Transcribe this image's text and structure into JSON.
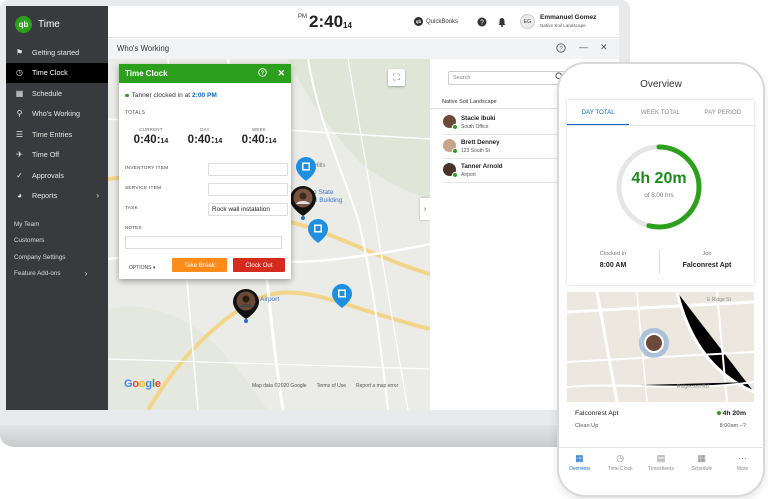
{
  "app": {
    "name": "Time",
    "logo": "qb"
  },
  "sidebar": {
    "items": [
      {
        "label": "Getting started",
        "icon": "flag-icon"
      },
      {
        "label": "Time Clock",
        "icon": "clock-icon",
        "active": true
      },
      {
        "label": "Schedule",
        "icon": "calendar-icon"
      },
      {
        "label": "Who's Working",
        "icon": "map-pin-icon"
      },
      {
        "label": "Time Entries",
        "icon": "list-icon"
      },
      {
        "label": "Time Off",
        "icon": "plane-icon"
      },
      {
        "label": "Approvals",
        "icon": "check-icon"
      },
      {
        "label": "Reports",
        "icon": "pie-chart-icon"
      }
    ],
    "links": [
      "My Team",
      "Customers",
      "Company Settings",
      "Feature Add-ons"
    ]
  },
  "header": {
    "ampm": "PM",
    "time": "2:40",
    "seconds": "14",
    "quickbooks_label": "QuickBooks",
    "qb_badge": "qb",
    "user_initials": "EG",
    "user_name": "Emmanuel Gomez",
    "company": "Native Soil Landscape"
  },
  "subheader": {
    "title": "Who's Working"
  },
  "time_clock": {
    "title": "Time Clock",
    "status_prefix": "Tanner clocked in at",
    "clock_in_time": "2:00 PM",
    "totals_label": "TOTALS",
    "totals": [
      {
        "label": "CURRENT",
        "value": "0:40:",
        "sec": "14"
      },
      {
        "label": "DAY",
        "value": "0:40:",
        "sec": "14"
      },
      {
        "label": "WEEK",
        "value": "0:40:",
        "sec": "14"
      }
    ],
    "fields": [
      {
        "label": "INVENTORY ITEM",
        "value": ""
      },
      {
        "label": "SERVICE ITEM",
        "value": ""
      },
      {
        "label": "TASK",
        "value": "Rock wall instalation"
      }
    ],
    "notes_label": "NOTES",
    "options_label": "OPTIONS ▾",
    "take_break_label": "Take Break",
    "clock_out_label": "Clock Out"
  },
  "map": {
    "labels": {
      "hills": "Hills",
      "state": "o State",
      "capitol": "l Building",
      "airport": "Airport",
      "google": "Google"
    },
    "footer": [
      "Map data ©2020 Google",
      "Terms of Use",
      "Report a map error"
    ]
  },
  "who_working": {
    "search_placeholder": "Search",
    "group": "Native Soil Landscape",
    "employees": [
      {
        "name": "Stacie Ibuki",
        "location": "South Office"
      },
      {
        "name": "Brett Denney",
        "location": "123 South St"
      },
      {
        "name": "Tanner Arnold",
        "location": "Airport"
      }
    ]
  },
  "phone": {
    "title": "Overview",
    "tabs": [
      "DAY TOTAL",
      "WEEK TOTAL",
      "PAY PERIOD"
    ],
    "ring_value": "4h 20m",
    "ring_sub": "of 8.00 hrs",
    "ring_progress": 0.54,
    "clocked_in_label": "Clocked In",
    "clocked_in_value": "8:00 AM",
    "job_label": "Job",
    "job_value": "Falconrest Apt",
    "map_street_1": "E Ridge St",
    "map_street_2": "Ridgecrest Rd",
    "loc_name": "Falconrest Apt",
    "loc_duration": "4h 20m",
    "loc_task": "Clean Up",
    "loc_range": "8:00am –?",
    "nav": [
      {
        "label": "Overview",
        "icon": "grid-icon",
        "active": true
      },
      {
        "label": "Time Clock",
        "icon": "clock-icon"
      },
      {
        "label": "Timesheets",
        "icon": "timesheet-icon"
      },
      {
        "label": "Schedule",
        "icon": "calendar-icon"
      },
      {
        "label": "More",
        "icon": "more-icon"
      }
    ]
  },
  "colors": {
    "brand_green": "#2ca01c",
    "orange": "#ff8c1a",
    "red": "#d52b1e",
    "link_blue": "#0a66c2",
    "sidebar": "#393a3d"
  }
}
